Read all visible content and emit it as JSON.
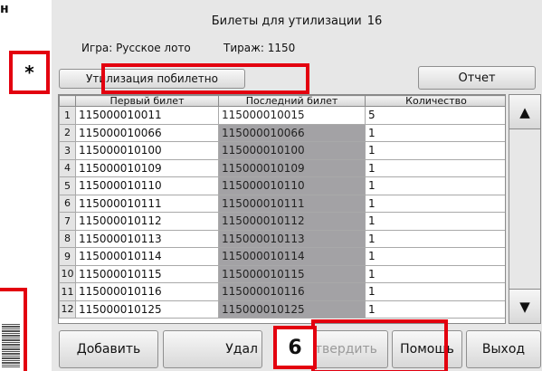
{
  "page": {
    "corner_char": "н"
  },
  "window": {
    "title": "Билеты для утилизации",
    "title_count": "16",
    "game_label": "Игра: Русское лото",
    "draw_label": "Тираж: 1150",
    "util_button": "Утилизация побилетно",
    "report_button": "Отчет"
  },
  "table": {
    "columns": [
      "Первый билет",
      "Последний билет",
      "Количество"
    ],
    "rows": [
      {
        "n": "1",
        "first": "115000010011",
        "last": "115000010015",
        "qty": "5"
      },
      {
        "n": "2",
        "first": "115000010066",
        "last": "115000010066",
        "qty": "1"
      },
      {
        "n": "3",
        "first": "115000010100",
        "last": "115000010100",
        "qty": "1"
      },
      {
        "n": "4",
        "first": "115000010109",
        "last": "115000010109",
        "qty": "1"
      },
      {
        "n": "5",
        "first": "115000010110",
        "last": "115000010110",
        "qty": "1"
      },
      {
        "n": "6",
        "first": "115000010111",
        "last": "115000010111",
        "qty": "1"
      },
      {
        "n": "7",
        "first": "115000010112",
        "last": "115000010112",
        "qty": "1"
      },
      {
        "n": "8",
        "first": "115000010113",
        "last": "115000010113",
        "qty": "1"
      },
      {
        "n": "9",
        "first": "115000010114",
        "last": "115000010114",
        "qty": "1"
      },
      {
        "n": "10",
        "first": "115000010115",
        "last": "115000010115",
        "qty": "1"
      },
      {
        "n": "11",
        "first": "115000010116",
        "last": "115000010116",
        "qty": "1"
      },
      {
        "n": "12",
        "first": "115000010125",
        "last": "115000010125",
        "qty": "1"
      }
    ]
  },
  "buttons": {
    "add": "Добавить",
    "delete": "Удал",
    "confirm": "Подтвердить",
    "help": "Помощь",
    "exit": "Выход"
  },
  "annotations": {
    "star": "*",
    "six": "6"
  },
  "colors": {
    "highlight_red": "#e3000f",
    "selected_cell": "#a3a2a5",
    "window_bg": "#e7e7e7"
  }
}
